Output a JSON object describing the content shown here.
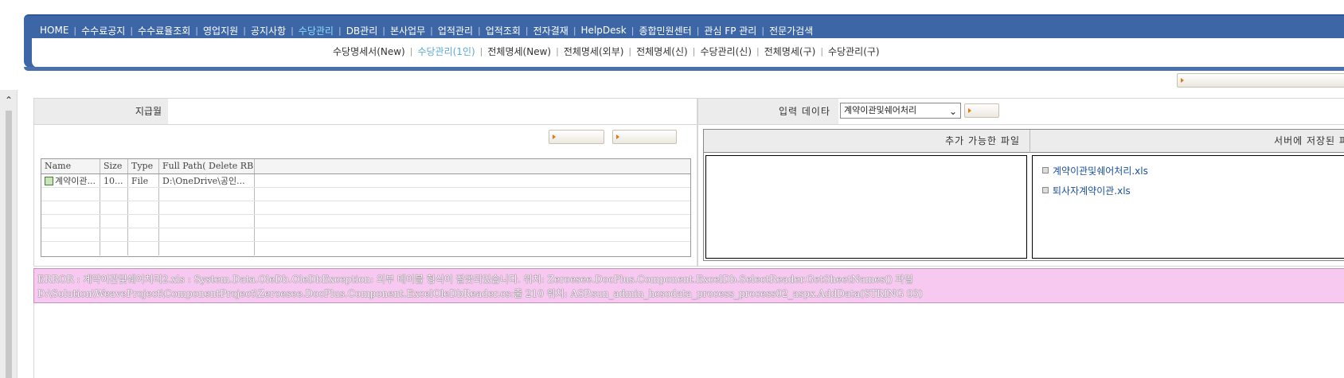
{
  "header": {
    "user_info_left": "",
    "user_info_right": ""
  },
  "main_menu": [
    {
      "label": "HOME",
      "active": false
    },
    {
      "label": "수수료공지",
      "active": false
    },
    {
      "label": "수수료율조회",
      "active": false
    },
    {
      "label": "영업지원",
      "active": false
    },
    {
      "label": "공지사항",
      "active": false
    },
    {
      "label": "수당관리",
      "active": true
    },
    {
      "label": "DB관리",
      "active": false
    },
    {
      "label": "본사업무",
      "active": false
    },
    {
      "label": "업적관리",
      "active": false
    },
    {
      "label": "업적조회",
      "active": false
    },
    {
      "label": "전자결재",
      "active": false
    },
    {
      "label": "HelpDesk",
      "active": false
    },
    {
      "label": "종합민원센터",
      "active": false
    },
    {
      "label": "관심 FP 관리",
      "active": false
    },
    {
      "label": "전문가검색",
      "active": false
    }
  ],
  "sub_menu": [
    {
      "label": "수당명세서(New)",
      "active": false
    },
    {
      "label": "수당관리(1인)",
      "active": true
    },
    {
      "label": "전체명세(New)",
      "active": false
    },
    {
      "label": "전체명세(외부)",
      "active": false
    },
    {
      "label": "전체명세(신)",
      "active": false
    },
    {
      "label": "수당관리(신)",
      "active": false
    },
    {
      "label": "전체명세(구)",
      "active": false
    },
    {
      "label": "수당관리(구)",
      "active": false
    }
  ],
  "left_panel": {
    "pay_month_label": "지급월",
    "pay_month_value": "",
    "grid": {
      "columns": [
        "Name",
        "Size",
        "Type",
        "Full Path( Delete RB..."
      ],
      "rows": [
        {
          "name": "계약이관...",
          "size": "10...",
          "type": "File",
          "path": "D:\\OneDrive\\공인..."
        }
      ]
    }
  },
  "right_panel": {
    "input_data_label": "입력 데이타",
    "selected_option": "계약이관및쉐어처리",
    "addable_files_header": "추가 가능한 파일",
    "server_files_header": "서버에 저장된 파일",
    "server_files": [
      "계약이관및쉐어처리.xls",
      "퇴사자계약이관.xls"
    ]
  },
  "error": {
    "line1": "ERROR : 계약이관및쉐어처리2.xls : System.Data.OleDb.OleDbException: 외부 테이블 형식이 잘못되었습니다. 위치: Zeroesee.DocPlus.Component.ExcelDb.SelectReader.GetSheetNames() 파일",
    "line2": "D:\\Solution\\WeaveProject\\ComponentProject\\Zeroesee.DocPlus.Component.ExcelOleDbReader.cs:줄 210 위치: ASP.sun_admin_hcsodata_process_process02_aspx.AddData(STRING 03)"
  }
}
